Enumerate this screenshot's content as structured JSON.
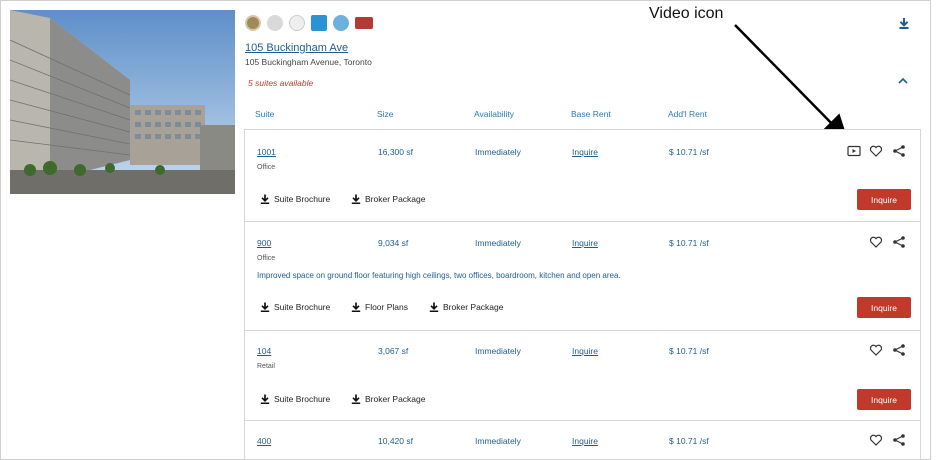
{
  "annotation": {
    "label": "Video icon"
  },
  "building": {
    "name": "105 Buckingham Ave",
    "address": "105 Buckingham Avenue, Toronto",
    "suites_available": "5 suites available"
  },
  "columns": [
    "Suite",
    "Size",
    "Availability",
    "Base Rent",
    "Add'l Rent"
  ],
  "suites": [
    {
      "suite": "1001",
      "type": "Office",
      "size": "16,300 sf",
      "availability": "Immediately",
      "base_rent": "Inquire",
      "addl_rent": "$ 10.71 /sf",
      "description": "",
      "downloads": [
        "Suite Brochure",
        "Broker Package"
      ],
      "button": "Inquire",
      "has_video": true
    },
    {
      "suite": "900",
      "type": "Office",
      "size": "9,034 sf",
      "availability": "Immediately",
      "base_rent": "Inquire",
      "addl_rent": "$ 10.71 /sf",
      "description": "Improved space on ground floor featuring high ceilings, two offices, boardroom, kitchen and open area.",
      "downloads": [
        "Suite Brochure",
        "Floor Plans",
        "Broker Package"
      ],
      "button": "Inquire",
      "has_video": false
    },
    {
      "suite": "104",
      "type": "Retail",
      "size": "3,067 sf",
      "availability": "Immediately",
      "base_rent": "Inquire",
      "addl_rent": "$ 10.71 /sf",
      "description": "",
      "downloads": [
        "Suite Brochure",
        "Broker Package"
      ],
      "button": "Inquire",
      "has_video": false
    },
    {
      "suite": "400",
      "type": "",
      "size": "10,420 sf",
      "availability": "Immediately",
      "base_rent": "Inquire",
      "addl_rent": "$ 10.71 /sf",
      "description": "",
      "downloads": [],
      "button": "",
      "has_video": false
    }
  ],
  "colors": {
    "link": "#1f5d8f",
    "header": "#2b7ab8",
    "accent": "#c0392b"
  }
}
